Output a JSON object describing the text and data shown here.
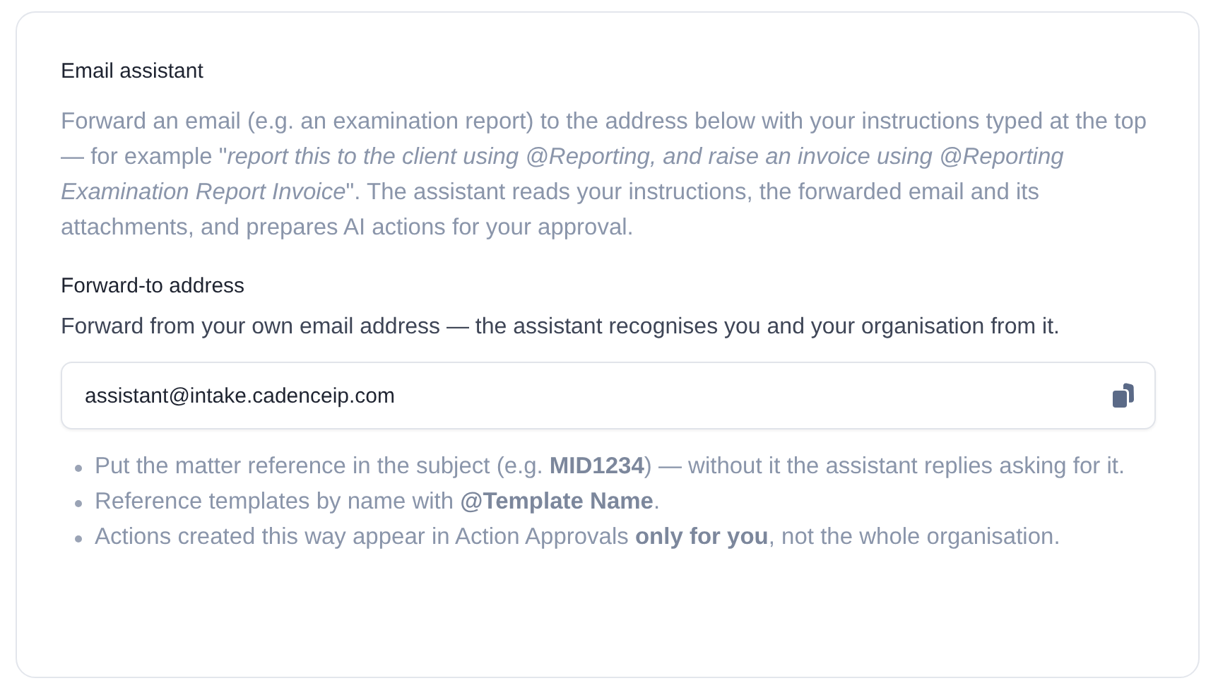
{
  "card": {
    "title": "Email assistant",
    "description": "Forward an email (e.g. an examination report) to the address below with your instructions typed at the top — for example \"*report this to the client using @Reporting, and raise an invoice using @Reporting Examination Report Invoice*\". The assistant reads your instructions, the forwarded email and its attachments, and prepares AI actions for your approval.",
    "section_title": "Forward-to address",
    "section_hint": "Forward from your own email address — the assistant recognises you and your organisation from it.",
    "address_field": {
      "value": "assistant@intake.cadenceip.com"
    },
    "tips": [
      "Put the matter reference in the subject (e.g. **MID1234**) — without it the assistant replies asking for it.",
      "Reference templates by name with **@Template Name**.",
      "Actions created this way appear in Action Approvals **only for you**, not the whole organisation."
    ]
  }
}
